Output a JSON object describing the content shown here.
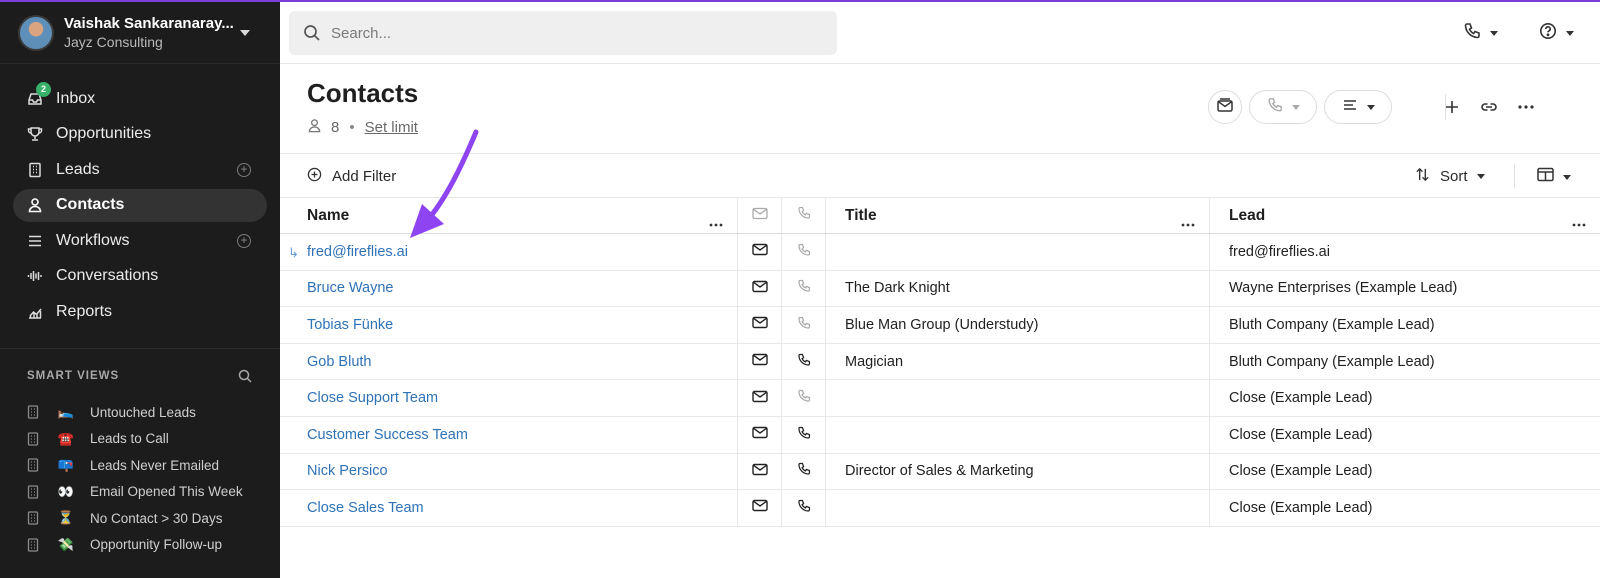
{
  "account": {
    "name": "Vaishak Sankaranaray...",
    "org": "Jayz Consulting"
  },
  "nav": {
    "items": [
      {
        "label": "Inbox",
        "badge": "2",
        "icon": "inbox-icon"
      },
      {
        "label": "Opportunities",
        "icon": "trophy-icon"
      },
      {
        "label": "Leads",
        "icon": "building-icon",
        "add": "+"
      },
      {
        "label": "Contacts",
        "icon": "person-icon",
        "active": true
      },
      {
        "label": "Workflows",
        "icon": "list-icon",
        "add": "+"
      },
      {
        "label": "Conversations",
        "icon": "waveform-icon"
      },
      {
        "label": "Reports",
        "icon": "chart-icon"
      }
    ]
  },
  "smart_views": {
    "heading": "SMART VIEWS",
    "items": [
      {
        "emoji": "🛌",
        "label": "Untouched Leads"
      },
      {
        "emoji": "☎️",
        "label": "Leads to Call"
      },
      {
        "emoji": "📪",
        "label": "Leads Never Emailed"
      },
      {
        "emoji": "👀",
        "label": "Email Opened This Week"
      },
      {
        "emoji": "⏳",
        "label": "No Contact > 30 Days"
      },
      {
        "emoji": "💸",
        "label": "Opportunity Follow-up"
      }
    ]
  },
  "search": {
    "placeholder": "Search..."
  },
  "page": {
    "title": "Contacts",
    "count": "8",
    "separator": "•",
    "set_limit": "Set limit"
  },
  "filters": {
    "add_filter": "Add Filter",
    "sort": "Sort"
  },
  "table": {
    "columns": {
      "name": "Name",
      "title": "Title",
      "lead": "Lead"
    },
    "rows": [
      {
        "name": "fred@fireflies.ai",
        "title": "",
        "lead": "fred@fireflies.ai",
        "sub": true,
        "phone_active": false
      },
      {
        "name": "Bruce Wayne",
        "title": "The Dark Knight",
        "lead": "Wayne Enterprises (Example Lead)",
        "phone_active": false
      },
      {
        "name": "Tobias Fünke",
        "title": "Blue Man Group (Understudy)",
        "lead": "Bluth Company (Example Lead)",
        "phone_active": false
      },
      {
        "name": "Gob Bluth",
        "title": "Magician",
        "lead": "Bluth Company (Example Lead)",
        "phone_active": true
      },
      {
        "name": "Close Support Team",
        "title": "",
        "lead": "Close (Example Lead)",
        "phone_active": false
      },
      {
        "name": "Customer Success Team",
        "title": "",
        "lead": "Close (Example Lead)",
        "phone_active": true
      },
      {
        "name": "Nick Persico",
        "title": "Director of Sales & Marketing",
        "lead": "Close (Example Lead)",
        "phone_active": true
      },
      {
        "name": "Close Sales Team",
        "title": "",
        "lead": "Close (Example Lead)",
        "phone_active": true
      }
    ]
  },
  "colors": {
    "accent": "#7b3fd6",
    "link": "#2e72b8",
    "sidebar_bg": "#1c1c1c",
    "badge": "#37b06a"
  }
}
